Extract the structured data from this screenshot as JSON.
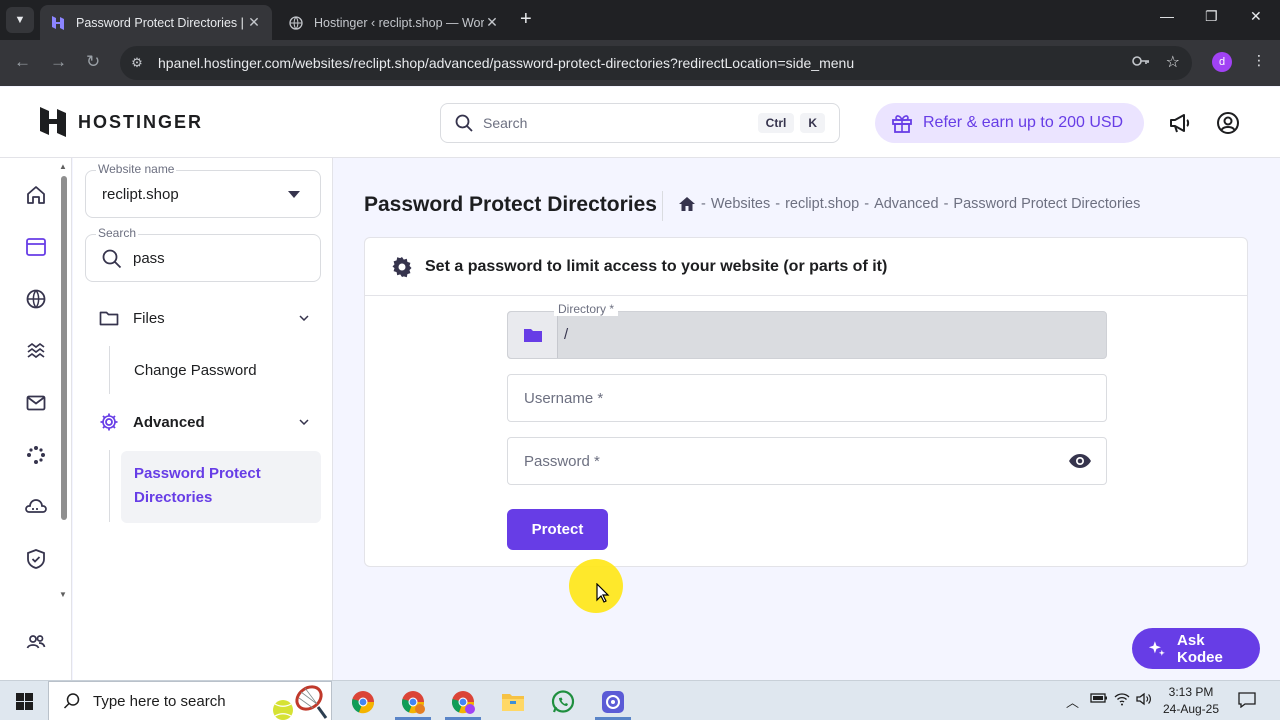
{
  "browser": {
    "tabs": [
      {
        "title": "Password Protect Directories | Hostinger",
        "active": true
      },
      {
        "title": "Hostinger ‹ reclipt.shop — WordPress",
        "active": false
      }
    ],
    "url": "hpanel.hostinger.com/websites/reclipt.shop/advanced/password-protect-directories?redirectLocation=side_menu",
    "profile_initial": "d"
  },
  "header": {
    "brand": "HOSTINGER",
    "search_placeholder": "Search",
    "kbd_ctrl": "Ctrl",
    "kbd_k": "K",
    "refer_label": "Refer & earn up to 200 USD"
  },
  "sidebar": {
    "website_label": "Website name",
    "website_value": "reclipt.shop",
    "search_label": "Search",
    "search_value": "pass",
    "files_label": "Files",
    "change_password": "Change Password",
    "advanced_label": "Advanced",
    "active_item": "Password Protect Directories"
  },
  "main": {
    "title": "Password Protect Directories",
    "breadcrumb": [
      "Websites",
      "reclipt.shop",
      "Advanced",
      "Password Protect Directories"
    ],
    "card_title": "Set a password to limit access to your website (or parts of it)",
    "directory_label": "Directory *",
    "directory_value": "/",
    "username_placeholder": "Username *",
    "password_placeholder": "Password *",
    "protect_label": "Protect"
  },
  "kodee": {
    "label": "Ask Kodee"
  },
  "taskbar": {
    "search_placeholder": "Type here to search",
    "time": "3:13 PM",
    "date": "24-Aug-25"
  },
  "colors": {
    "accent": "#673de6",
    "accent_light": "#ebe4ff",
    "page_bg": "#f4f5ff"
  }
}
